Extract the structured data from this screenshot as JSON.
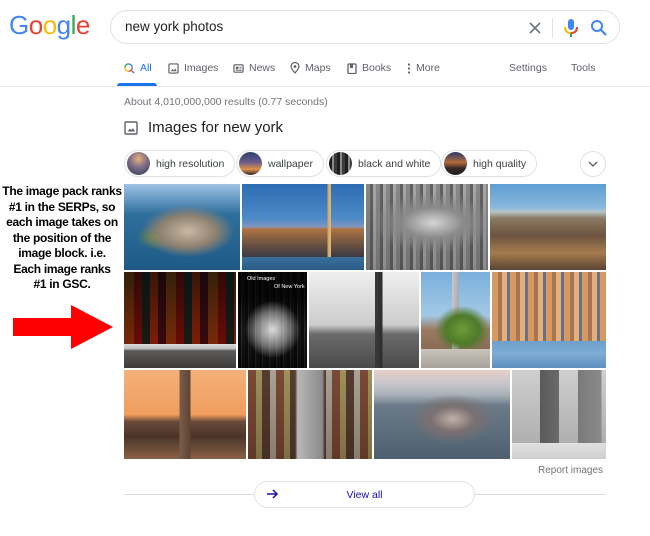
{
  "logo": {
    "letters": [
      {
        "ch": "G",
        "color": "#4285f4"
      },
      {
        "ch": "o",
        "color": "#ea4335"
      },
      {
        "ch": "o",
        "color": "#fbbc05"
      },
      {
        "ch": "g",
        "color": "#4285f4"
      },
      {
        "ch": "l",
        "color": "#34a853"
      },
      {
        "ch": "e",
        "color": "#ea4335"
      }
    ]
  },
  "search": {
    "query": "new york photos",
    "clear_icon": "close-icon",
    "voice_icon": "microphone-icon",
    "submit_icon": "search-icon"
  },
  "tabs": [
    {
      "label": "All",
      "icon": "search-icon",
      "active": true
    },
    {
      "label": "Images",
      "icon": "image-icon",
      "active": false
    },
    {
      "label": "News",
      "icon": "newspaper-icon",
      "active": false
    },
    {
      "label": "Maps",
      "icon": "map-pin-icon",
      "active": false
    },
    {
      "label": "Books",
      "icon": "book-icon",
      "active": false
    },
    {
      "label": "More",
      "icon": "more-vertical-icon",
      "active": false
    },
    {
      "label": "Settings",
      "active": false
    },
    {
      "label": "Tools",
      "active": false
    }
  ],
  "result_stats": "About 4,010,000,000 results (0.77 seconds)",
  "images_section": {
    "title": "Images for new york",
    "icon": "image-icon",
    "chips": [
      {
        "label": "high resolution"
      },
      {
        "label": "wallpaper"
      },
      {
        "label": "black and white"
      },
      {
        "label": "high quality"
      }
    ],
    "expand_icon": "chevron-down-icon",
    "tiles": [
      {
        "alt": "Aerial view of Lower Manhattan"
      },
      {
        "alt": "Lower Manhattan skyline at dusk"
      },
      {
        "alt": "Black and white aerial of Manhattan"
      },
      {
        "alt": "Aerial view over Central Park"
      },
      {
        "alt": "Times Square theater signs at night"
      },
      {
        "alt": "Old Images Of New York",
        "caption_line1": "Old Images",
        "caption_line2": "Of New York"
      },
      {
        "alt": "Black and white Empire State Building"
      },
      {
        "alt": "Street view toward Empire State Building"
      },
      {
        "alt": "Midtown skyline across the Hudson"
      },
      {
        "alt": "Empire State Building at orange sunset"
      },
      {
        "alt": "Busy downtown street from above"
      },
      {
        "alt": "Aerial of Manhattan island at dawn"
      },
      {
        "alt": "Flatiron building in winter, black and white"
      }
    ],
    "report_label": "Report images",
    "view_all_label": "View all",
    "view_all_icon": "arrow-right-icon"
  },
  "annotation": {
    "lines": [
      "The image pack ranks",
      "#1 in the SERPs, so",
      "each image takes on",
      "the position of the",
      "image block. i.e.",
      "Each image ranks",
      "#1 in GSC."
    ],
    "arrow_color": "#ff0000",
    "arrow_icon": "arrow-right-icon"
  },
  "colors": {
    "accent": "#1a73e8",
    "link": "#1a0dab",
    "muted": "#70757a"
  }
}
